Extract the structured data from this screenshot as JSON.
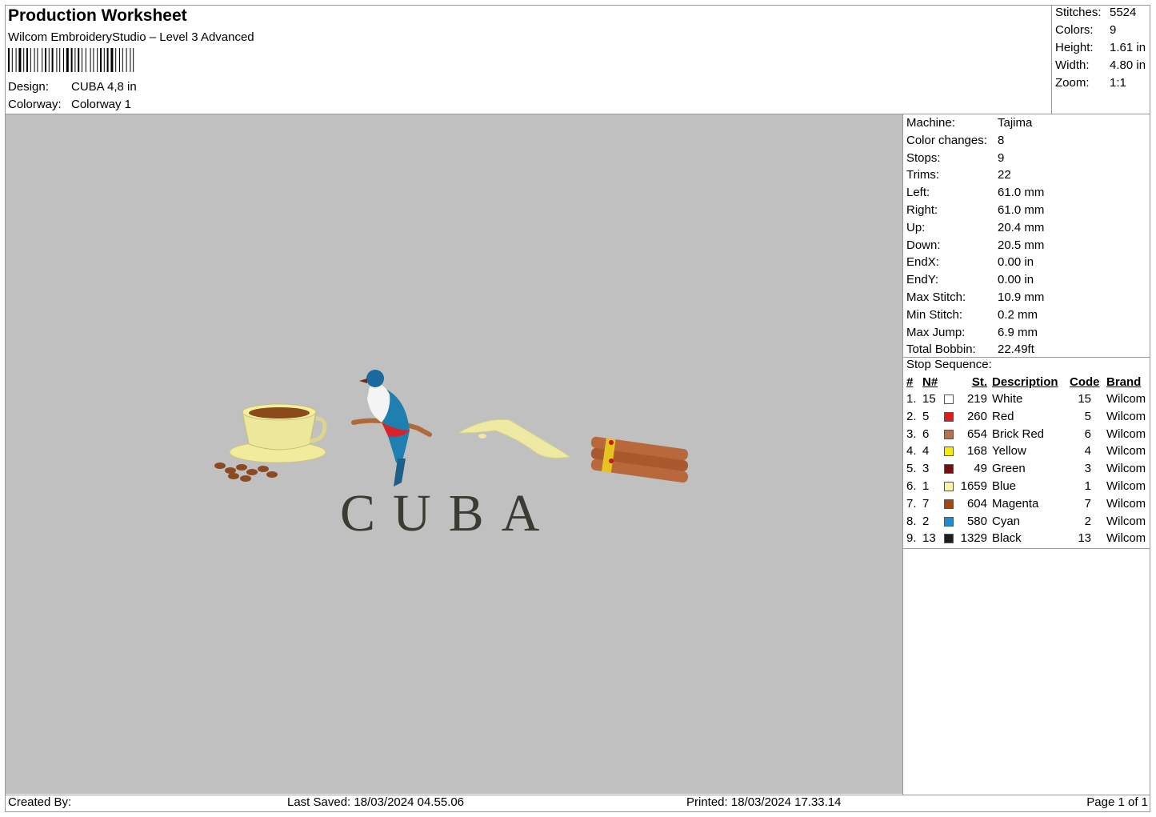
{
  "header": {
    "title": "Production Worksheet",
    "software": "Wilcom EmbroideryStudio – Level 3 Advanced",
    "design_label": "Design:",
    "design_value": "CUBA 4,8 in",
    "colorway_label": "Colorway:",
    "colorway_value": "Colorway 1"
  },
  "summary": {
    "stitches_label": "Stitches:",
    "stitches": "5524",
    "colors_label": "Colors:",
    "colors": "9",
    "height_label": "Height:",
    "height": "1.61 in",
    "width_label": "Width:",
    "width": "4.80 in",
    "zoom_label": "Zoom:",
    "zoom": "1:1"
  },
  "preview": {
    "text": "CUBA",
    "background_color": "#c0c0c0",
    "letter_color": "#3b3a33"
  },
  "specs": [
    {
      "label": "Machine:",
      "value": "Tajima"
    },
    {
      "label": "Color changes:",
      "value": "8"
    },
    {
      "label": "Stops:",
      "value": "9"
    },
    {
      "label": "Trims:",
      "value": "22"
    },
    {
      "label": "Left:",
      "value": "61.0 mm"
    },
    {
      "label": "Right:",
      "value": "61.0 mm"
    },
    {
      "label": "Up:",
      "value": "20.4 mm"
    },
    {
      "label": "Down:",
      "value": "20.5 mm"
    },
    {
      "label": "EndX:",
      "value": "0.00 in"
    },
    {
      "label": "EndY:",
      "value": "0.00 in"
    },
    {
      "label": "Max Stitch:",
      "value": "10.9 mm"
    },
    {
      "label": "Min Stitch:",
      "value": "0.2 mm"
    },
    {
      "label": "Max Jump:",
      "value": "6.9 mm"
    },
    {
      "label": "Total Bobbin:",
      "value": "22.49ft"
    }
  ],
  "stop_sequence": {
    "title": "Stop Sequence:",
    "headers": {
      "num": "#",
      "needle": "N#",
      "stitches": "St.",
      "description": "Description",
      "code": "Code",
      "brand": "Brand"
    },
    "rows": [
      {
        "num": "1.",
        "needle": "15",
        "color": "#ffffff",
        "stitches": "219",
        "description": "White",
        "code": "15",
        "brand": "Wilcom"
      },
      {
        "num": "2.",
        "needle": "5",
        "color": "#e01b1b",
        "stitches": "260",
        "description": "Red",
        "code": "5",
        "brand": "Wilcom"
      },
      {
        "num": "3.",
        "needle": "6",
        "color": "#b5734a",
        "stitches": "654",
        "description": "Brick Red",
        "code": "6",
        "brand": "Wilcom"
      },
      {
        "num": "4.",
        "needle": "4",
        "color": "#f5ee00",
        "stitches": "168",
        "description": "Yellow",
        "code": "4",
        "brand": "Wilcom"
      },
      {
        "num": "5.",
        "needle": "3",
        "color": "#7a0d0d",
        "stitches": "49",
        "description": "Green",
        "code": "3",
        "brand": "Wilcom"
      },
      {
        "num": "6.",
        "needle": "1",
        "color": "#fbf3a6",
        "stitches": "1659",
        "description": "Blue",
        "code": "1",
        "brand": "Wilcom"
      },
      {
        "num": "7.",
        "needle": "7",
        "color": "#a5470f",
        "stitches": "604",
        "description": "Magenta",
        "code": "7",
        "brand": "Wilcom"
      },
      {
        "num": "8.",
        "needle": "2",
        "color": "#1a8fd8",
        "stitches": "580",
        "description": "Cyan",
        "code": "2",
        "brand": "Wilcom"
      },
      {
        "num": "9.",
        "needle": "13",
        "color": "#1e1e1e",
        "stitches": "1329",
        "description": "Black",
        "code": "13",
        "brand": "Wilcom"
      }
    ]
  },
  "footer": {
    "created_by": "Created By:",
    "last_saved": "Last Saved: 18/03/2024 04.55.06",
    "printed": "Printed: 18/03/2024 17.33.14",
    "page": "Page 1 of 1"
  }
}
